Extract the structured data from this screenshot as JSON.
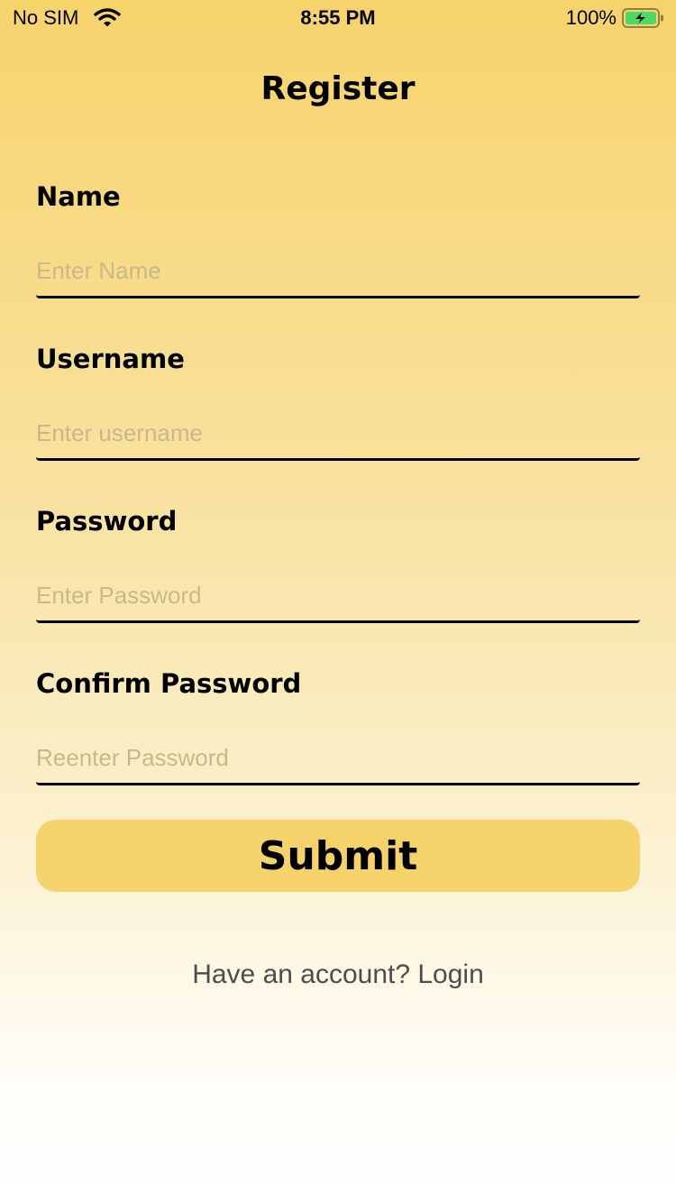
{
  "status_bar": {
    "carrier": "No SIM",
    "time": "8:55 PM",
    "battery_percent": "100%",
    "wifi_icon": "wifi-icon",
    "battery_icon": "battery-charging-icon",
    "battery_color": "#4cd964"
  },
  "page": {
    "title": "Register"
  },
  "form": {
    "name": {
      "label": "Name",
      "placeholder": "Enter Name",
      "value": ""
    },
    "username": {
      "label": "Username",
      "placeholder": "Enter username",
      "value": ""
    },
    "password": {
      "label": "Password",
      "placeholder": "Enter Password",
      "value": ""
    },
    "confirm_password": {
      "label": "Confirm Password",
      "placeholder": "Reenter Password",
      "value": ""
    },
    "submit_label": "Submit"
  },
  "footer": {
    "login_text": "Have an account? Login"
  },
  "colors": {
    "accent": "#f6d26a",
    "background_top": "#f7d36c",
    "background_bottom": "#ffffff",
    "placeholder": "#c9b88a"
  }
}
